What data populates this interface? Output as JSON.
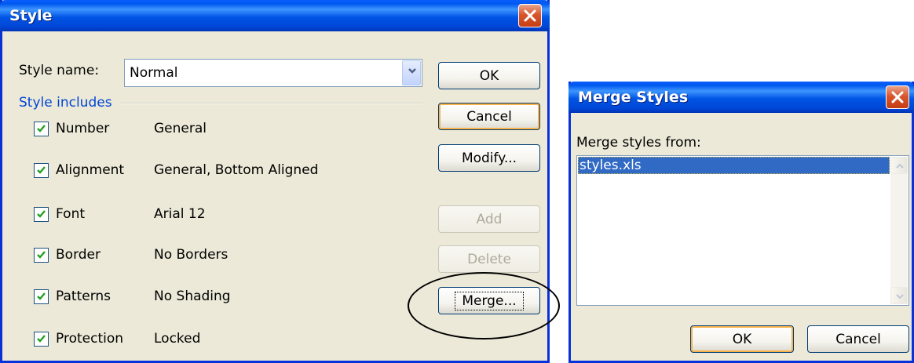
{
  "style_dialog": {
    "title": "Style",
    "style_name_label": "Style name:",
    "style_name_value": "Normal",
    "group_label": "Style includes",
    "items": [
      {
        "name": "Number",
        "value": "General",
        "checked": true
      },
      {
        "name": "Alignment",
        "value": "General, Bottom Aligned",
        "checked": true
      },
      {
        "name": "Font",
        "value": "Arial 12",
        "checked": true
      },
      {
        "name": "Border",
        "value": "No Borders",
        "checked": true
      },
      {
        "name": "Patterns",
        "value": "No Shading",
        "checked": true
      },
      {
        "name": "Protection",
        "value": "Locked",
        "checked": true
      }
    ],
    "buttons": {
      "ok": "OK",
      "cancel": "Cancel",
      "modify": "Modify...",
      "add": "Add",
      "delete": "Delete",
      "merge": "Merge..."
    }
  },
  "merge_dialog": {
    "title": "Merge Styles",
    "list_label": "Merge styles from:",
    "list_items": [
      "styles.xls"
    ],
    "selected_item": "styles.xls",
    "buttons": {
      "ok": "OK",
      "cancel": "Cancel"
    }
  },
  "icons": {
    "close": "close-icon",
    "dropdown": "chevron-down-icon",
    "checkbox": "check-icon",
    "scroll_up": "scroll-up-icon",
    "scroll_down": "scroll-down-icon"
  },
  "colors": {
    "titlebar": "#0058ee",
    "dialog_bg": "#ece9d8",
    "group_label": "#0046d5",
    "selection": "#316ac5",
    "close_button": "#d9562d"
  }
}
